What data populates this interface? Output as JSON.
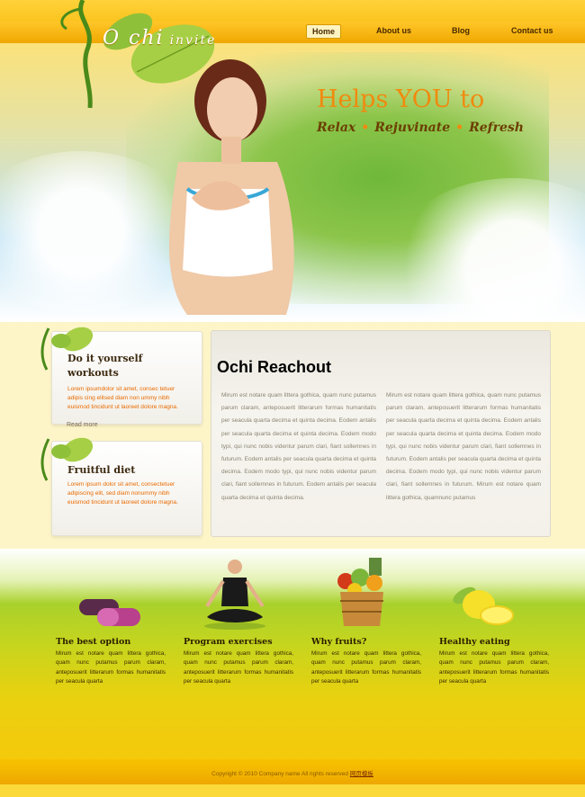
{
  "logo": {
    "text": "O chi",
    "small": "invite"
  },
  "nav": [
    "Home",
    "About us",
    "Blog",
    "Contact us"
  ],
  "hero": {
    "title": "Helps YOU to",
    "subtitle": [
      "Relax",
      "Rejuvinate",
      "Refresh"
    ]
  },
  "sidebar": {
    "card1": {
      "title": "Do it yourself workouts",
      "text": "Lorem ipsumdolor sit amet, consec tetuer adipis cing elitsed diam non ummy nibh euismod tincidunt ut laoreet dolore magna.",
      "read_more": "Read more"
    },
    "card2": {
      "title": "Fruitful diet",
      "text": "Lorem ipsum dolor sit amet, consectetuer adipiscing elit, sed diam nonummy nibh euismod tincidunt ut laoreet dolore magna."
    }
  },
  "reachout": {
    "title": "Ochi Reachout",
    "col1": "Mirum est notare quam littera gothica, quam nunc putamus parum claram, anteposuerit litterarum formas humanitatis per seacula quarta decima et quinta decima. Eodem antalis per seacula quarta decima et quinta decima. Eodem modo typi, qui nunc nobis videntur parum clari, fiant sollemnes in futurum. Eodem antalis per seacula quarta decima et quinta decima. Eodem modo typi, qui nunc nobis videntur parum clari, fiant sollemnes in futurum. Eodem antalis per seacula quarta decima et quinta decima.",
    "col2": "Mirum est notare quam littera gothica, quam nunc putamus parum claram, anteposuerit litterarum formas humanitatis per seacula quarta decima et quinta decima. Eodem antalis per seacula quarta decima et quinta decima. Eodem modo typi, qui nunc nobis videntur parum clari, fiant sollemnes in futurum. Eodem antalis per seacula quarta decima et quinta decima. Eodem modo typi, qui nunc nobis videntur parum clari, fiant sollemnes in futurum. Mirum est notare quam littera gothica, quamnunc putamus"
  },
  "features": [
    {
      "title": "The best option",
      "text": "Mirum est notare quam littera gothica, quam nunc putamus parum claram, anteposuerit litterarum formas humanitatis per seacula quarta"
    },
    {
      "title": "Program exercises",
      "text": "Mirum est notare quam littera gothica, quam nunc putamus parum claram, anteposuerit litterarum formas humanitatis per seacula quarta"
    },
    {
      "title": "Why fruits?",
      "text": "Mirum est notare quam littera gothica, quam nunc putamus parum claram, anteposuerit litterarum formas humanitatis per seacula quarta"
    },
    {
      "title": "Healthy eating",
      "text": "Mirum est notare quam littera gothica, quam nunc putamus parum claram, anteposuerit litterarum formas humanitatis per seacula quarta"
    }
  ],
  "footer": {
    "copyright": "Copyright © 2010 Company name All rights reserved",
    "link": "网页模板"
  },
  "colors": {
    "accent": "#f08a0e",
    "nav_bg": "#f7b300",
    "card_text": "#e96a00"
  }
}
